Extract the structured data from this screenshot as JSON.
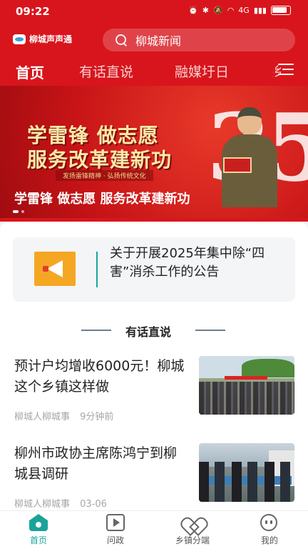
{
  "status_bar": {
    "time": "09:22",
    "right_icons": [
      "alarm-icon",
      "bluetooth-icon",
      "mute-icon",
      "wifi-icon",
      "signal-icon",
      "battery-icon"
    ],
    "network_label": "4G"
  },
  "app": {
    "name": "柳城声声通",
    "accent_color": "#d8151c",
    "secondary_color": "#1aa39a"
  },
  "search": {
    "placeholder": "柳城新闻"
  },
  "tabs": [
    {
      "label": "首页",
      "active": true
    },
    {
      "label": "有话直说",
      "active": false
    },
    {
      "label": "融媒圩日",
      "active": false
    },
    {
      "label": "乡",
      "active": false
    }
  ],
  "banner": {
    "line1": "学雷锋 做志愿",
    "line2": "服务改革建新功",
    "subline": "发扬雷锋精神 · 弘扬传统文化",
    "big_mark": "35",
    "caption": "学雷锋 做志愿 服务改革建新功",
    "slide_index": 1,
    "slide_count": 2
  },
  "notice": {
    "text": "关于开展2025年集中除“四害”消杀工作的公告",
    "icon": "megaphone-icon"
  },
  "section": {
    "title": "有话直说"
  },
  "news": [
    {
      "title": "预计户均增收6000元！柳城这个乡镇这样做",
      "source": "柳城人柳城事",
      "time": "9分钟前"
    },
    {
      "title": "柳州市政协主席陈鸿宁到柳城县调研",
      "source": "柳城人柳城事",
      "time": "03-06"
    }
  ],
  "bottom_nav": [
    {
      "label": "首页",
      "icon": "home-icon",
      "active": true
    },
    {
      "label": "问政",
      "icon": "video-icon",
      "active": false
    },
    {
      "label": "乡镇分端",
      "icon": "heart-icon",
      "active": false
    },
    {
      "label": "我的",
      "icon": "profile-icon",
      "active": false
    }
  ]
}
